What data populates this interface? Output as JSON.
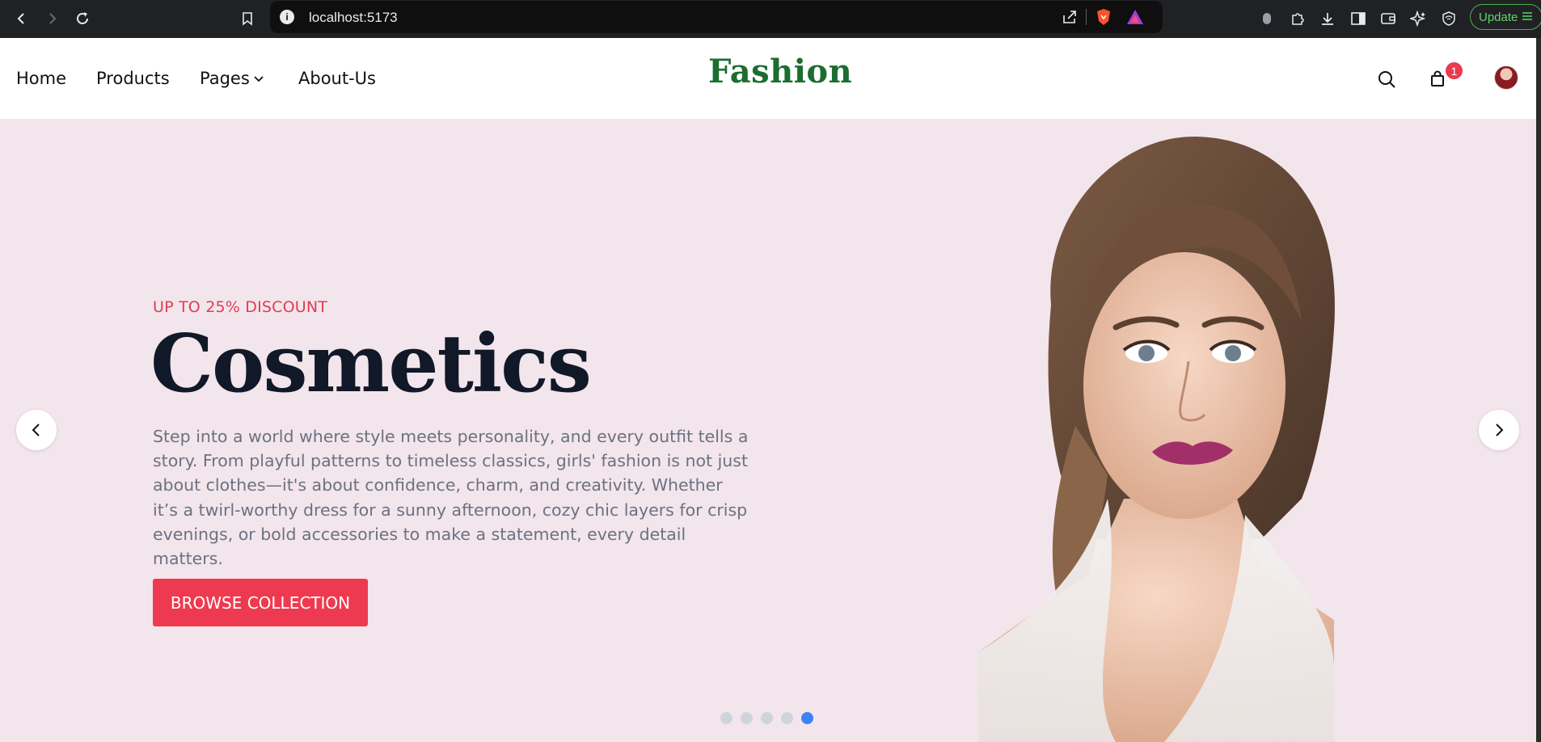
{
  "browser": {
    "url": "localhost:5173",
    "update_label": "Update",
    "colors": {
      "chrome": "#202124",
      "address": "#0f0f10",
      "update": "#5fd36a"
    }
  },
  "header": {
    "nav": [
      {
        "label": "Home"
      },
      {
        "label": "Products"
      },
      {
        "label": "Pages"
      },
      {
        "label": "About-Us"
      }
    ],
    "brand": "Fashion",
    "cart_count": "1",
    "colors": {
      "brand": "#1b6e2f",
      "badge": "#ea3a4f"
    }
  },
  "hero": {
    "discount": "UP TO 25% DISCOUNT",
    "title": "Cosmetics",
    "description": "Step into a world where style meets personality, and every outfit tells a story. From playful patterns to timeless classics, girls' fashion is not just about clothes—it's about confidence, charm, and creativity. Whether it’s a twirl-worthy dress for a sunny afternoon, cozy chic layers for crisp evenings, or bold accessories to make a statement, every detail matters.",
    "cta_label": "BROWSE COLLECTION",
    "slides_total": 5,
    "active_slide": 5,
    "colors": {
      "background": "#f3e5ec",
      "accent": "#ee3a50",
      "active_dot": "#3b82f6"
    }
  }
}
